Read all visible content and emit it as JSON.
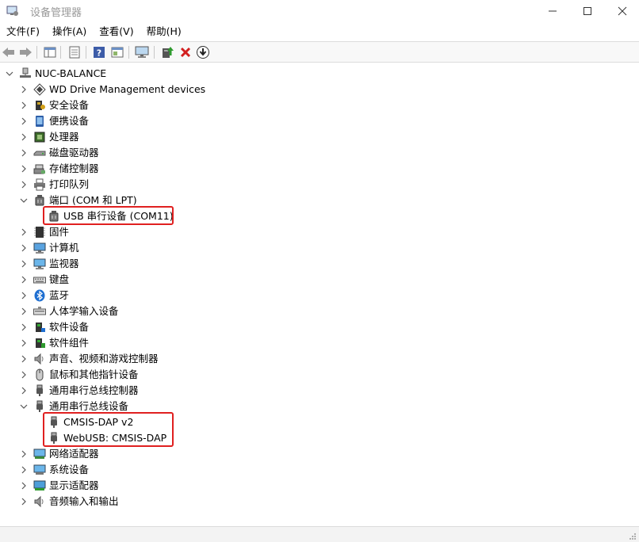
{
  "window": {
    "title": "设备管理器"
  },
  "menu": [
    "文件(F)",
    "操作(A)",
    "查看(V)",
    "帮助(H)"
  ],
  "toolbar": {
    "buttons": [
      "back-icon",
      "forward-icon",
      "show-hide-tree-icon",
      "properties-icon",
      "help-icon",
      "view-icon",
      "monitor-icon",
      "update-driver-icon",
      "uninstall-icon",
      "scan-download-icon"
    ]
  },
  "tree": {
    "root": "NUC-BALANCE",
    "categories": [
      {
        "label": "WD Drive Management devices",
        "icon": "wd-icon"
      },
      {
        "label": "安全设备",
        "icon": "security-icon"
      },
      {
        "label": "便携设备",
        "icon": "portable-icon"
      },
      {
        "label": "处理器",
        "icon": "cpu-icon"
      },
      {
        "label": "磁盘驱动器",
        "icon": "disk-icon"
      },
      {
        "label": "存储控制器",
        "icon": "storage-icon"
      },
      {
        "label": "打印队列",
        "icon": "printer-icon"
      },
      {
        "label": "端口 (COM 和 LPT)",
        "icon": "port-icon",
        "expanded": true,
        "children": [
          {
            "label": "USB 串行设备 (COM11)",
            "icon": "usb-serial-icon",
            "highlighted": true
          }
        ]
      },
      {
        "label": "固件",
        "icon": "firmware-icon"
      },
      {
        "label": "计算机",
        "icon": "computer-icon"
      },
      {
        "label": "监视器",
        "icon": "monitor-icon"
      },
      {
        "label": "键盘",
        "icon": "keyboard-icon"
      },
      {
        "label": "蓝牙",
        "icon": "bluetooth-icon"
      },
      {
        "label": "人体学输入设备",
        "icon": "hid-icon"
      },
      {
        "label": "软件设备",
        "icon": "software-device-icon"
      },
      {
        "label": "软件组件",
        "icon": "software-component-icon"
      },
      {
        "label": "声音、视频和游戏控制器",
        "icon": "sound-icon"
      },
      {
        "label": "鼠标和其他指针设备",
        "icon": "mouse-icon"
      },
      {
        "label": "通用串行总线控制器",
        "icon": "usb-controller-icon"
      },
      {
        "label": "通用串行总线设备",
        "icon": "usb-device-icon",
        "expanded": true,
        "children": [
          {
            "label": "CMSIS-DAP v2",
            "icon": "usb-device-icon",
            "highlighted": true
          },
          {
            "label": "WebUSB: CMSIS-DAP",
            "icon": "usb-device-icon",
            "highlighted": true
          }
        ]
      },
      {
        "label": "网络适配器",
        "icon": "network-icon"
      },
      {
        "label": "系统设备",
        "icon": "system-icon"
      },
      {
        "label": "显示适配器",
        "icon": "display-icon"
      },
      {
        "label": "音频输入和输出",
        "icon": "audio-icon"
      }
    ]
  },
  "colors": {
    "highlight": "#e02020",
    "titleText": "#999999",
    "chevron": "#555555"
  }
}
